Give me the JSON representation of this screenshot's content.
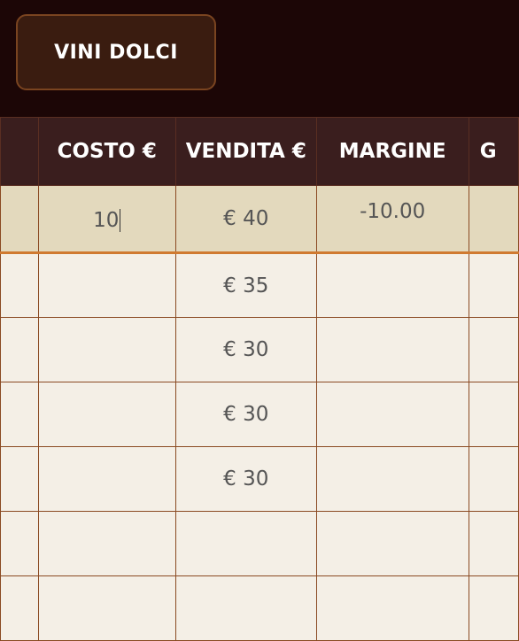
{
  "toolbar": {
    "category_button_label": "VINI DOLCI"
  },
  "table": {
    "headers": [
      "",
      "COSTO €",
      "VENDITA €",
      "MARGINE",
      "G"
    ],
    "active_row": {
      "cost_value": "10",
      "sale": "€ 40",
      "margin": "-10.00"
    },
    "rows": [
      {
        "sale": "€ 35"
      },
      {
        "sale": "€ 30"
      },
      {
        "sale": "€ 30"
      },
      {
        "sale": "€ 30"
      },
      {
        "sale": ""
      },
      {
        "sale": ""
      }
    ]
  }
}
